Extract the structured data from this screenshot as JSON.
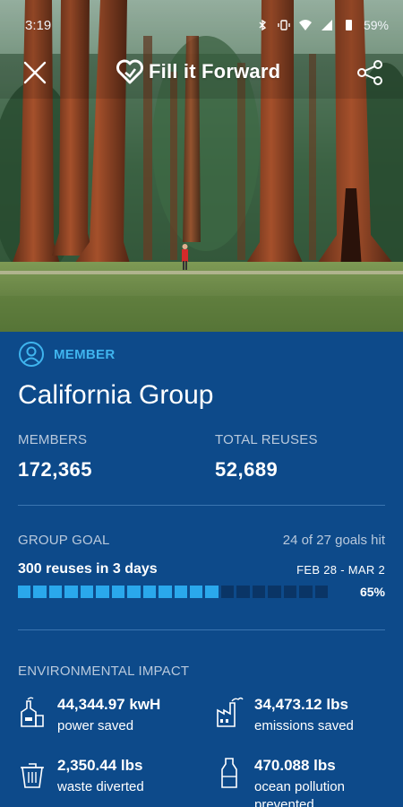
{
  "status_bar": {
    "time": "3:19",
    "battery": "59%"
  },
  "header": {
    "brand": "Fill it Forward"
  },
  "group": {
    "role": "MEMBER",
    "name": "California Group",
    "members_label": "MEMBERS",
    "members_value": "172,365",
    "reuses_label": "TOTAL REUSES",
    "reuses_value": "52,689"
  },
  "goal": {
    "label": "GROUP GOAL",
    "goals_hit": "24 of 27 goals hit",
    "description": "300 reuses in 3 days",
    "dates": "FEB 28 - MAR 2",
    "percent_text": "65%",
    "progress_fraction": 0.65
  },
  "impact": {
    "label": "ENVIRONMENTAL IMPACT",
    "items": [
      {
        "value": "44,344.97 kwH",
        "desc": "power saved",
        "icon": "power-plant-icon"
      },
      {
        "value": "34,473.12 lbs",
        "desc": "emissions saved",
        "icon": "factory-icon"
      },
      {
        "value": "2,350.44 lbs",
        "desc": "waste diverted",
        "icon": "trash-icon"
      },
      {
        "value": "470.088 lbs",
        "desc": "ocean pollution prevented",
        "icon": "bottle-icon"
      }
    ]
  },
  "colors": {
    "panel_bg": "#0d4a8a",
    "accent": "#3fb4ee",
    "progress_on": "#2aa8ec",
    "progress_off": "#0a3566"
  }
}
